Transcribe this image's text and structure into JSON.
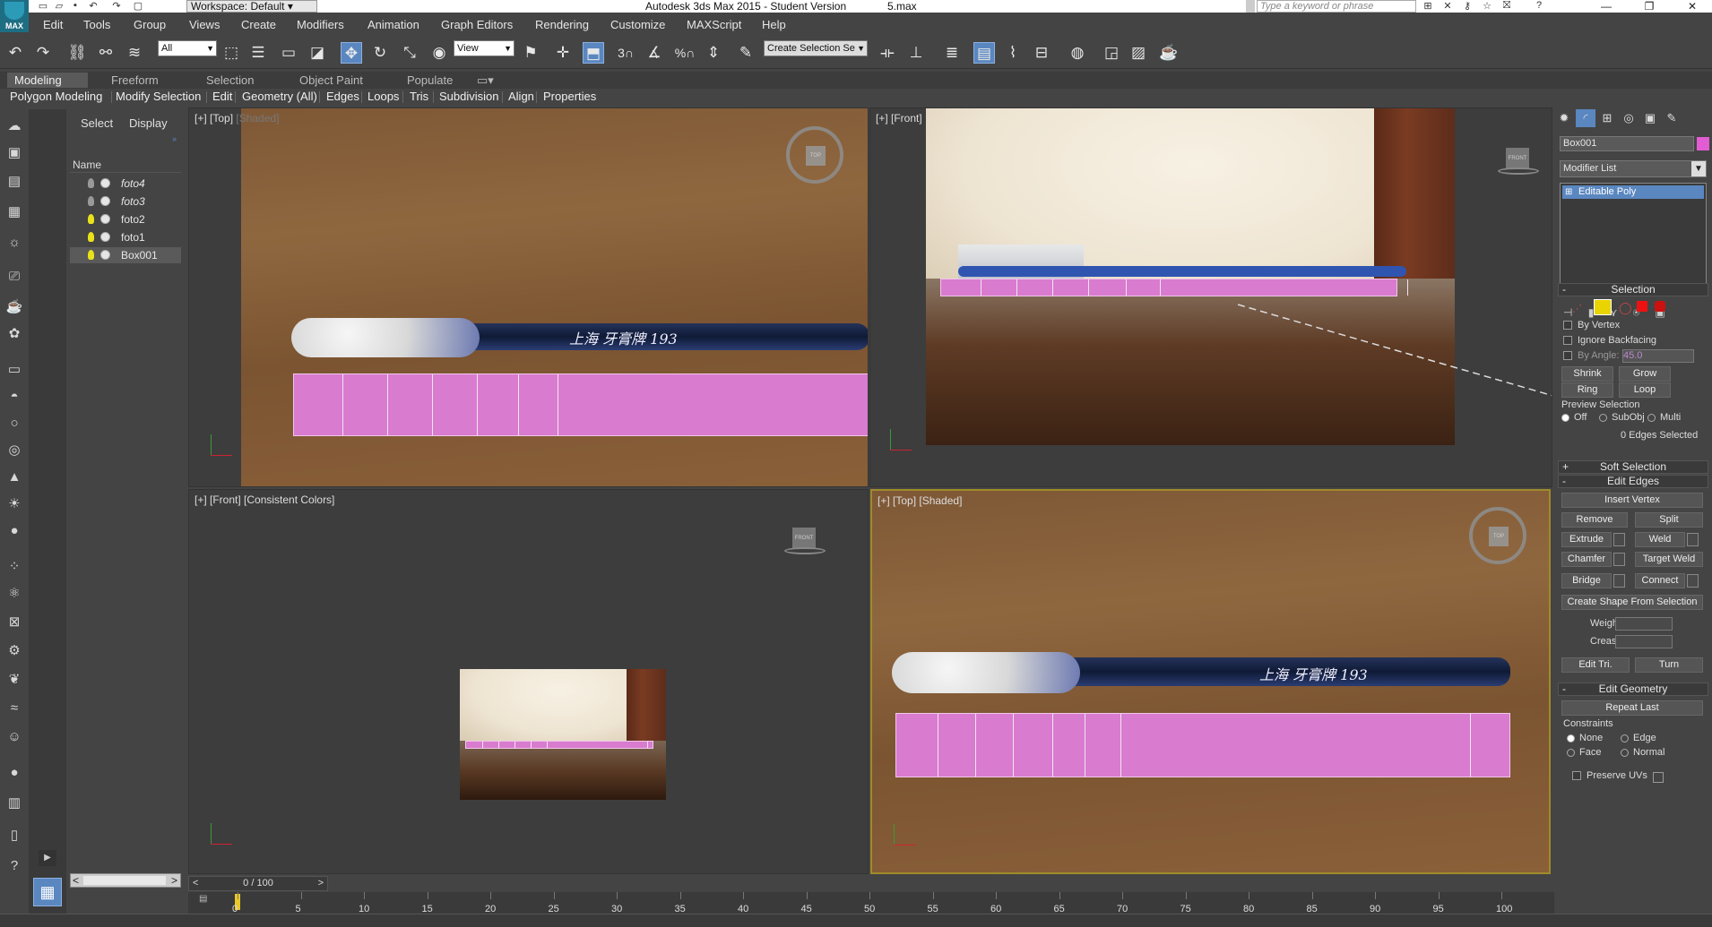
{
  "title": {
    "app": "Autodesk 3ds Max  2015  - Student Version",
    "file": "5.max",
    "workspace": "Workspace: Default",
    "search_placeholder": "Type a keyword or phrase",
    "logo": "MAX"
  },
  "menu": [
    "Edit",
    "Tools",
    "Group",
    "Views",
    "Create",
    "Modifiers",
    "Animation",
    "Graph Editors",
    "Rendering",
    "Customize",
    "MAXScript",
    "Help"
  ],
  "toolbar": {
    "selection_filter": "All",
    "ref_coord": "View",
    "named_selection": "Create Selection Se",
    "snap_3": "3",
    "percent": "%"
  },
  "ribbon": {
    "tabs": [
      "Modeling",
      "Freeform",
      "Selection",
      "Object Paint",
      "Populate"
    ],
    "items": [
      "Polygon Modeling",
      "Modify Selection",
      "Edit",
      "Geometry (All)",
      "Edges",
      "Loops",
      "Tris",
      "Subdivision",
      "Align",
      "Properties"
    ]
  },
  "scene_explorer": {
    "tabs": [
      "Select",
      "Display"
    ],
    "column": "Name",
    "items": [
      {
        "name": "foto4"
      },
      {
        "name": "foto3"
      },
      {
        "name": "foto2"
      },
      {
        "name": "foto1"
      },
      {
        "name": "Box001"
      }
    ]
  },
  "viewports": {
    "top_left": {
      "label_a": "[+] [Top] ",
      "label_b": "[Shaded]",
      "cube": "TOP"
    },
    "top_right": {
      "label_a": "[+] [Front]",
      "label_b": "",
      "cube": "FRONT"
    },
    "bottom_left": {
      "label_a": "[+] [Front] [Consistent Colors]",
      "label_b": "",
      "cube": "FRONT"
    },
    "bottom_right": {
      "label_a": "[+] [Top] [Shaded]",
      "label_b": "",
      "cube": "TOP"
    },
    "brush_text": "上海 牙膏牌 193"
  },
  "command_panel": {
    "object_name": "Box001",
    "object_color": "#e25cd3",
    "modifier_list": "Modifier List",
    "stack_item": "Editable Poly",
    "selection": {
      "title": "Selection",
      "by_vertex": "By Vertex",
      "ignore_backfacing": "Ignore Backfacing",
      "by_angle": "By Angle:",
      "angle_value": "45.0",
      "shrink": "Shrink",
      "grow": "Grow",
      "ring": "Ring",
      "loop": "Loop",
      "preview": "Preview Selection",
      "off": "Off",
      "subobj": "SubObj",
      "multi": "Multi",
      "status": "0 Edges Selected"
    },
    "soft_selection": "Soft Selection",
    "edit_edges": {
      "title": "Edit Edges",
      "insert_vertex": "Insert Vertex",
      "remove": "Remove",
      "split": "Split",
      "extrude": "Extrude",
      "weld": "Weld",
      "chamfer": "Chamfer",
      "target_weld": "Target Weld",
      "bridge": "Bridge",
      "connect": "Connect",
      "create_shape": "Create Shape From Selection",
      "weight": "Weight:",
      "crease": "Crease:",
      "edit_tri": "Edit Tri.",
      "turn": "Turn"
    },
    "edit_geometry": {
      "title": "Edit Geometry",
      "repeat_last": "Repeat Last",
      "constraints": "Constraints",
      "none": "None",
      "edge": "Edge",
      "face": "Face",
      "normal": "Normal",
      "preserve_uvs": "Preserve UVs"
    }
  },
  "timeline": {
    "slider": "0 / 100",
    "ticks": [
      "0",
      "5",
      "10",
      "15",
      "20",
      "25",
      "30",
      "35",
      "40",
      "45",
      "50",
      "55",
      "60",
      "65",
      "70",
      "75",
      "80",
      "85",
      "90",
      "95",
      "100"
    ]
  }
}
